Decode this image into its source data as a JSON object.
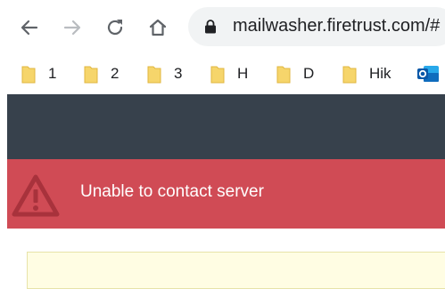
{
  "browser": {
    "url": "mailwasher.firetrust.com/#",
    "nav_icons": [
      "back-arrow-icon",
      "forward-arrow-icon",
      "reload-icon",
      "home-icon"
    ],
    "bookmarks": [
      {
        "label": "1",
        "icon": "folder-icon"
      },
      {
        "label": "2",
        "icon": "folder-icon"
      },
      {
        "label": "3",
        "icon": "folder-icon"
      },
      {
        "label": "H",
        "icon": "folder-icon"
      },
      {
        "label": "D",
        "icon": "folder-icon"
      },
      {
        "label": "Hik",
        "icon": "folder-icon"
      },
      {
        "label": "",
        "icon": "outlook-icon"
      }
    ]
  },
  "page": {
    "alert": {
      "message": "Unable to contact server",
      "icon": "warning-triangle-icon"
    }
  },
  "colors": {
    "header": "#37414c",
    "alert": "#d04b55",
    "notice": "#fffde3",
    "folder": "#f6d56b",
    "outlook": "#0f6cbd"
  }
}
